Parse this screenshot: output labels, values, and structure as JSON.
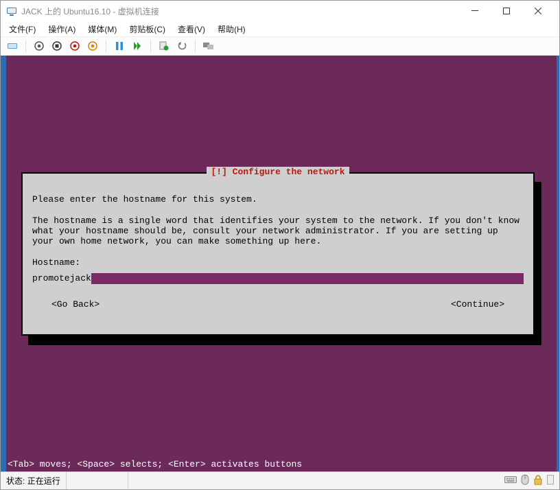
{
  "window": {
    "title": "JACK 上的 Ubuntu16.10 - 虚拟机连接"
  },
  "menu": {
    "file": "文件(F)",
    "action": "操作(A)",
    "media": "媒体(M)",
    "clipboard": "剪贴板(C)",
    "view": "查看(V)",
    "help": "帮助(H)"
  },
  "installer": {
    "dialog_title_raw": "[!] Configure the network",
    "intro": "Please enter the hostname for this system.",
    "desc": "The hostname is a single word that identifies your system to the network. If you don't know what your hostname should be, consult your network administrator. If you are setting up your own home network, you can make something up here.",
    "hostname_label": "Hostname:",
    "hostname_value": "promotejack",
    "go_back": "<Go Back>",
    "continue": "<Continue>",
    "bottom_hint": "<Tab> moves; <Space> selects; <Enter> activates buttons"
  },
  "status": {
    "label": "状态:",
    "value": "正在运行"
  },
  "icons": {
    "app": "app-icon",
    "minimize": "minimize-icon",
    "maximize": "maximize-icon",
    "close": "close-icon"
  }
}
